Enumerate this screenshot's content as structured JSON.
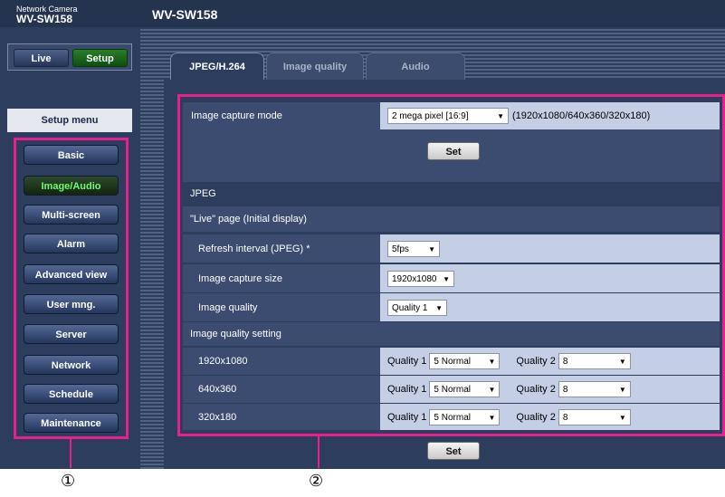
{
  "header": {
    "brand_sub": "Network Camera",
    "brand_model": "WV-SW158",
    "page_title": "WV-SW158"
  },
  "mode": {
    "live": "Live",
    "setup": "Setup"
  },
  "sidebar": {
    "menu_title": "Setup menu",
    "items": [
      {
        "label": "Basic",
        "active": false
      },
      {
        "label": "Image/Audio",
        "active": true
      },
      {
        "label": "Multi-screen",
        "active": false
      },
      {
        "label": "Alarm",
        "active": false
      },
      {
        "label": "Advanced view",
        "active": false
      },
      {
        "label": "User mng.",
        "active": false
      },
      {
        "label": "Server",
        "active": false
      },
      {
        "label": "Network",
        "active": false
      },
      {
        "label": "Schedule",
        "active": false
      },
      {
        "label": "Maintenance",
        "active": false
      }
    ]
  },
  "tabs": [
    {
      "label": "JPEG/H.264",
      "active": true
    },
    {
      "label": "Image quality",
      "active": false
    },
    {
      "label": "Audio",
      "active": false
    }
  ],
  "capture": {
    "label": "Image capture mode",
    "value": "2 mega pixel [16:9]",
    "note": "(1920x1080/640x360/320x180)"
  },
  "set_label": "Set",
  "jpeg": {
    "section": "JPEG",
    "live_section": "\"Live\" page (Initial display)",
    "refresh_label": "Refresh interval (JPEG) *",
    "refresh_value": "5fps",
    "size_label": "Image capture size",
    "size_value": "1920x1080",
    "quality_label": "Image quality",
    "quality_value": "Quality 1",
    "quality_setting": "Image quality setting",
    "resolutions": [
      {
        "label": "1920x1080",
        "q1_label": "Quality 1",
        "q1": "5 Normal",
        "q2_label": "Quality 2",
        "q2": "8"
      },
      {
        "label": "640x360",
        "q1_label": "Quality 1",
        "q1": "5 Normal",
        "q2_label": "Quality 2",
        "q2": "8"
      },
      {
        "label": "320x180",
        "q1_label": "Quality 1",
        "q1": "5 Normal",
        "q2_label": "Quality 2",
        "q2": "8"
      }
    ]
  },
  "callouts": [
    "①",
    "②"
  ],
  "colors": {
    "highlight": "#e8208f",
    "active_menu": "#6cff6c",
    "panel": "#2d3d5d",
    "value_cell": "#c4cfe6"
  }
}
